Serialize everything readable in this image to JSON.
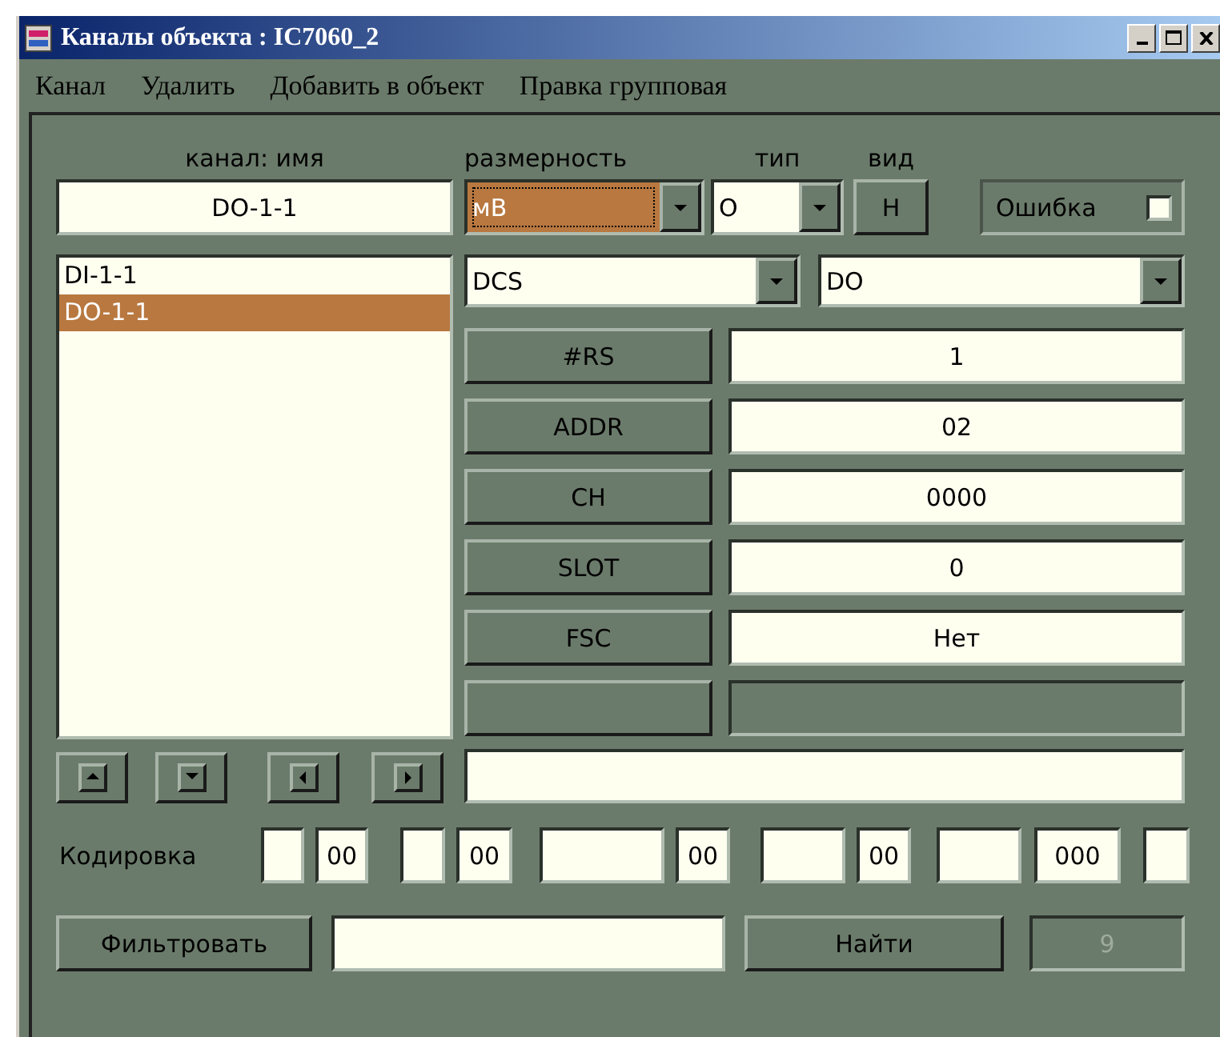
{
  "window": {
    "title": "Каналы объекта : IC7060_2"
  },
  "menu": [
    "Канал",
    "Удалить",
    "Добавить в объект",
    "Правка групповая"
  ],
  "headers": {
    "name": "канал: имя",
    "dimension": "размерность",
    "type": "тип",
    "view": "вид"
  },
  "name_field": {
    "value": "DO-1-1"
  },
  "dimension": {
    "value": "мВ",
    "focused": true
  },
  "type": {
    "value": "O"
  },
  "view_button": "Н",
  "error": {
    "label": "Ошибка",
    "checked": false
  },
  "channels": [
    {
      "label": "DI-1-1",
      "selected": false
    },
    {
      "label": "DO-1-1",
      "selected": true
    }
  ],
  "system": {
    "value": "DCS"
  },
  "signal": {
    "value": "DO"
  },
  "params": [
    {
      "label": "#RS",
      "value": "1"
    },
    {
      "label": "ADDR",
      "value": "02"
    },
    {
      "label": "CH",
      "value": "0000"
    },
    {
      "label": "SLOT",
      "value": "0"
    },
    {
      "label": "FSC",
      "value": "Нет"
    }
  ],
  "coding": {
    "label": "Кодировка",
    "fields": [
      {
        "kind": "blank"
      },
      {
        "kind": "code",
        "value": "00"
      },
      {
        "kind": "blank"
      },
      {
        "kind": "code",
        "value": "00"
      },
      {
        "kind": "blank"
      },
      {
        "kind": "code",
        "value": "00"
      },
      {
        "kind": "blank"
      },
      {
        "kind": "code",
        "value": "00"
      },
      {
        "kind": "blank"
      },
      {
        "kind": "code",
        "value": "000"
      },
      {
        "kind": "blank"
      }
    ]
  },
  "filter_button": "Фильтровать",
  "find_button": "Найти",
  "count": {
    "value": "9",
    "disabled": true
  }
}
